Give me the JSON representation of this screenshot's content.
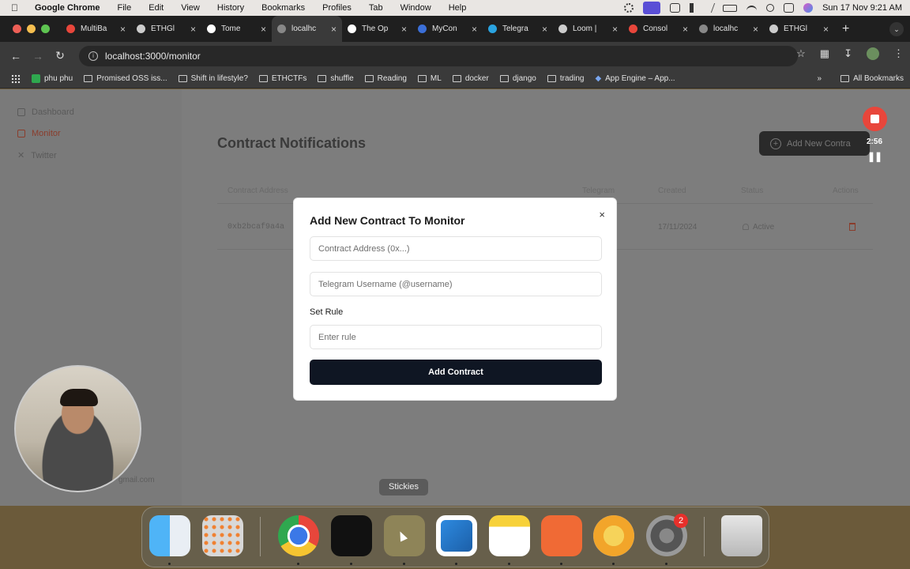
{
  "menubar": {
    "app_name": "Google Chrome",
    "items": [
      "File",
      "Edit",
      "View",
      "History",
      "Bookmarks",
      "Profiles",
      "Tab",
      "Window",
      "Help"
    ],
    "datetime": "Sun 17 Nov  9:21 AM"
  },
  "tabs": [
    {
      "title": "MultiBa",
      "color": "#e8463b"
    },
    {
      "title": "ETHGl",
      "color": "#cccccc"
    },
    {
      "title": "Tome",
      "color": "#ffffff"
    },
    {
      "title": "localhc",
      "color": "#888888",
      "active": true
    },
    {
      "title": "The Op",
      "color": "#ffffff"
    },
    {
      "title": "MyCon",
      "color": "#3b6fd8"
    },
    {
      "title": "Telegra",
      "color": "#2aa3e0"
    },
    {
      "title": "Loom |",
      "color": "#cccccc"
    },
    {
      "title": "Consol",
      "color": "#e8463b"
    },
    {
      "title": "localhc",
      "color": "#888888"
    },
    {
      "title": "ETHGl",
      "color": "#cccccc"
    }
  ],
  "address_bar": {
    "url": "localhost:3000/monitor"
  },
  "bookmarks": {
    "items": [
      "phu phu",
      "Promised OSS iss...",
      "Shift in lifestyle?",
      "ETHCTFs",
      "shuffle",
      "Reading",
      "ML",
      "docker",
      "django",
      "trading",
      "App Engine – App..."
    ],
    "all_label": "All Bookmarks"
  },
  "sidebar": {
    "items": [
      {
        "label": "Dashboard"
      },
      {
        "label": "Monitor"
      },
      {
        "label": "Twitter"
      }
    ],
    "user_email": "gmail.com"
  },
  "main": {
    "title": "Contract Notifications",
    "add_button": "Add New Contra",
    "table": {
      "headers": [
        "Contract Address",
        "Telegram",
        "Created",
        "Status",
        "Actions"
      ],
      "rows": [
        {
          "address": "0xb2bcaf9a4a",
          "created": "17/11/2024",
          "status": "Active"
        }
      ]
    }
  },
  "modal": {
    "title": "Add New Contract To Monitor",
    "address_placeholder": "Contract Address (0x...)",
    "telegram_placeholder": "Telegram Username (@username)",
    "rule_label": "Set Rule",
    "rule_placeholder": "Enter rule",
    "submit_label": "Add Contract",
    "close_icon": "×"
  },
  "recorder": {
    "time": "2:56"
  },
  "dock": {
    "tooltip": "Stickies",
    "badge_count": "2"
  }
}
